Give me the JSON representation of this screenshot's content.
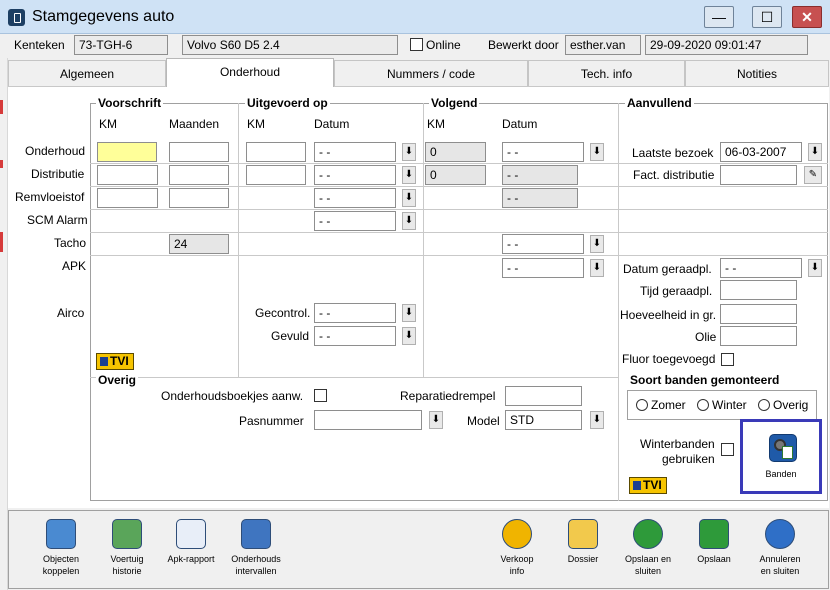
{
  "window": {
    "title": "Stamgegevens auto",
    "minimize": "—",
    "maximize": "☐",
    "close": "✕"
  },
  "header": {
    "kenteken_label": "Kenteken",
    "kenteken": "73-TGH-6",
    "model": "Volvo S60 D5 2.4",
    "online_label": "Online",
    "bewerkt_label": "Bewerkt door",
    "bewerkt_door": "esther.van",
    "datetime": "29-09-2020 09:01:47"
  },
  "tabs": [
    {
      "label": "Algemeen"
    },
    {
      "label": "Onderhoud"
    },
    {
      "label": "Nummers / code"
    },
    {
      "label": "Tech. info"
    },
    {
      "label": "Notities"
    }
  ],
  "sections": {
    "voorschrift": "Voorschrift",
    "uitgevoerd": "Uitgevoerd op",
    "volgend": "Volgend",
    "aanvullend": "Aanvullend",
    "km": "KM",
    "maanden": "Maanden",
    "datum": "Datum"
  },
  "rows": {
    "onderhoud": "Onderhoud",
    "distributie": "Distributie",
    "remvloeistof": "Remvloeistof",
    "scm_alarm": "SCM Alarm",
    "tacho": "Tacho",
    "apk": "APK",
    "airco": "Airco"
  },
  "values": {
    "date_empty": "- -",
    "km_volgend_onderhoud": "0",
    "km_volgend_distributie": "0",
    "tacho_maanden": "24",
    "gecontrol": "Gecontrol.",
    "gevuld": "Gevuld"
  },
  "aanvullend": {
    "laatste_bezoek_label": "Laatste bezoek",
    "laatste_bezoek": "06-03-2007",
    "fact_distributie_label": "Fact. distributie",
    "datum_geraadpl_label": "Datum geraadpl.",
    "tijd_geraadpl_label": "Tijd geraadpl.",
    "hoeveelheid_label": "Hoeveelheid in gr.",
    "olie_label": "Olie",
    "fluor_label": "Fluor toegevoegd"
  },
  "overig": {
    "title": "Overig",
    "boekjes_label": "Onderhoudsboekjes aanw.",
    "reparatiedrempel_label": "Reparatiedrempel",
    "pasnummer_label": "Pasnummer",
    "model_label": "Model",
    "model_value": "STD"
  },
  "banden": {
    "title": "Soort banden gemonteerd",
    "options": [
      "Zomer",
      "Winter",
      "Overig"
    ],
    "winter_label_1": "Winterbanden",
    "winter_label_2": "gebruiken",
    "button_label": "Banden"
  },
  "tvi_label": "TVI",
  "toolbar": {
    "objecten_1": "Objecten",
    "objecten_2": "koppelen",
    "voertuig_1": "Voertuig",
    "voertuig_2": "historie",
    "apk_rapport": "Apk-rapport",
    "intervallen_1": "Onderhouds",
    "intervallen_2": "intervallen",
    "verkoop_1": "Verkoop",
    "verkoop_2": "info",
    "dossier": "Dossier",
    "opslaan_sluiten_1": "Opslaan en",
    "opslaan_sluiten_2": "sluiten",
    "opslaan": "Opslaan",
    "annuleren_1": "Annuleren",
    "annuleren_2": "en sluiten"
  },
  "colors": {
    "highlight_field": "#ffff99",
    "banden_border": "#3a3ab8",
    "tvi": "#f6c400"
  }
}
